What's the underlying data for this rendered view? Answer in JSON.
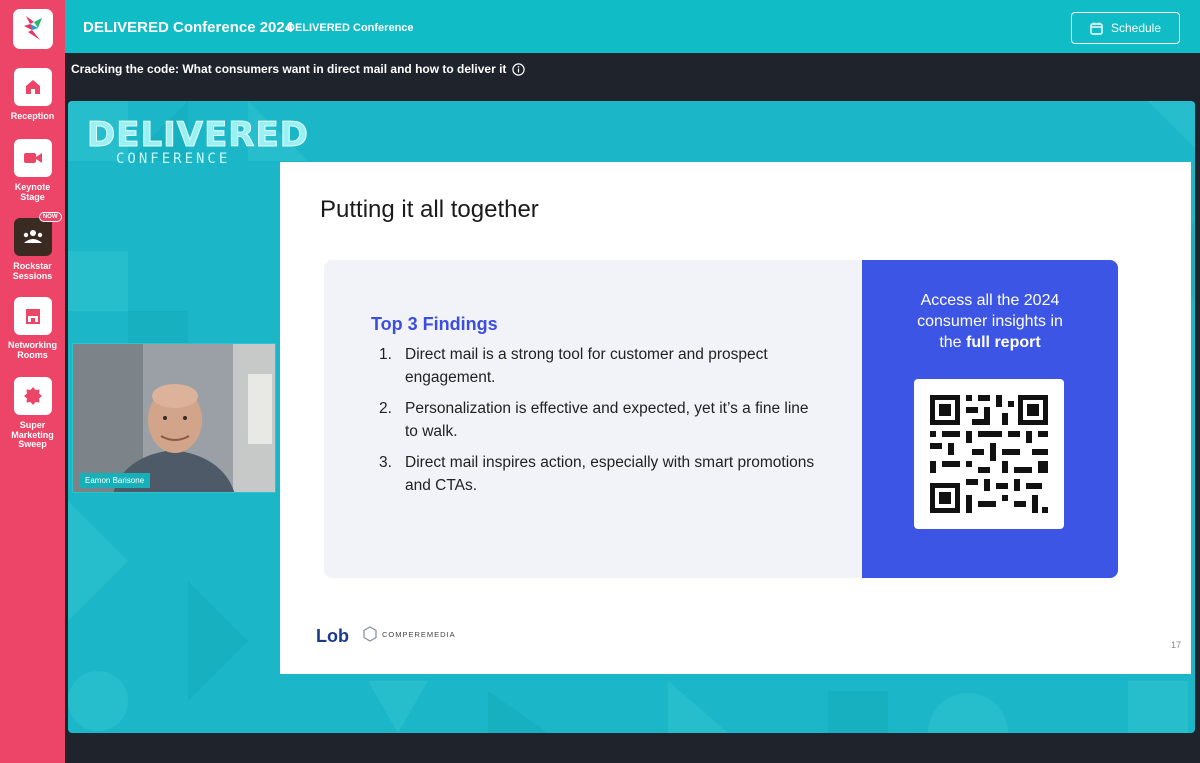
{
  "app": {
    "title": "DELIVERED Conference 2024",
    "subtitle": "DELIVERED Conference",
    "schedule_label": "Schedule"
  },
  "sidebar": {
    "items": [
      {
        "label": "Reception",
        "icon": "home-icon"
      },
      {
        "label": "Keynote Stage",
        "icon": "video-camera-icon"
      },
      {
        "label": "Rockstar Sessions",
        "icon": "audience-icon",
        "badge": "NOW"
      },
      {
        "label": "Networking Rooms",
        "icon": "storefront-icon"
      },
      {
        "label": "Super Marketing Sweep",
        "icon": "sale-badge-icon"
      }
    ]
  },
  "session": {
    "title": "Cracking the code: What consumers want in direct mail and how to deliver it"
  },
  "stream": {
    "brand_title": "DELIVERED",
    "brand_sub": "CONFERENCE",
    "speaker_name": "Eamon Barisone",
    "slide": {
      "title": "Putting it all together",
      "findings_title": "Top 3 Findings",
      "findings": [
        {
          "num": "1.",
          "text": "Direct mail is a strong tool for customer and prospect engagement."
        },
        {
          "num": "2.",
          "text": "Personalization is effective and expected, yet it’s a fine line to walk."
        },
        {
          "num": "3.",
          "text": "Direct mail inspires action, especially with smart promotions and CTAs."
        }
      ],
      "qr_text_line1": "Access all the 2024",
      "qr_text_line2": "consumer insights in",
      "qr_text_line3_pre": "the ",
      "qr_text_line3_bold": "full report",
      "footer_logo": "Lob",
      "footer_partner": "COMPEREMEDIA",
      "page_number": "17"
    }
  },
  "colors": {
    "sidebar": "#ec4567",
    "header": "#10bcc6",
    "stream_bg": "#1bb7c8",
    "qr_panel": "#3d55e4",
    "findings_title": "#3b4ee0"
  }
}
